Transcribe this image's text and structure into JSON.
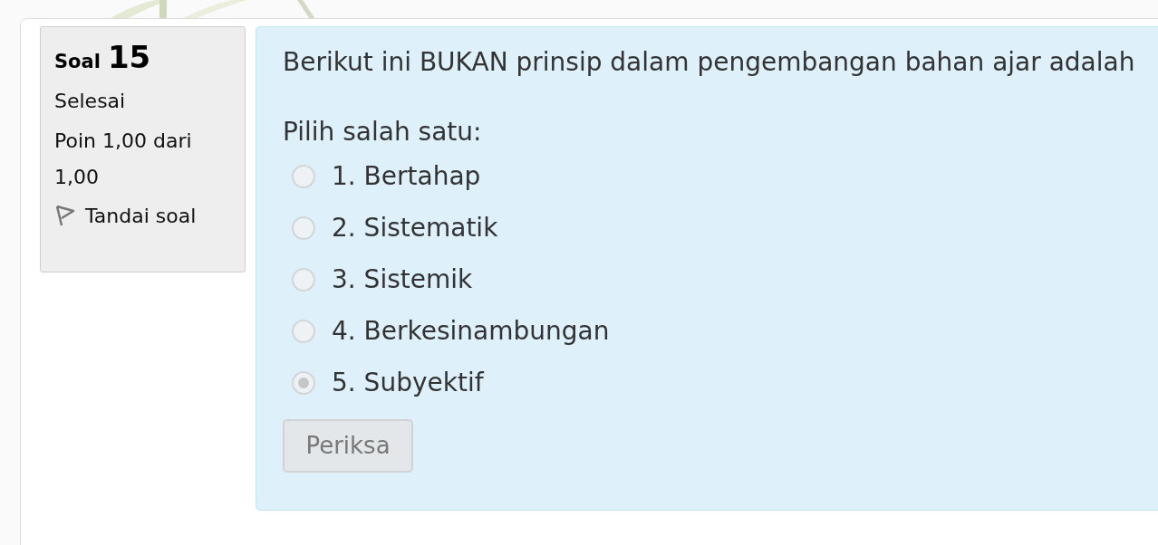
{
  "question_info": {
    "label": "Soal",
    "number": "15",
    "status": "Selesai",
    "grade": "Poin 1,00 dari 1,00",
    "flag": "Tandai soal"
  },
  "question": {
    "text": "Berikut ini BUKAN prinsip dalam pengembangan bahan ajar adalah",
    "prompt": "Pilih salah satu:",
    "options": [
      {
        "label": "1. Bertahap",
        "selected": false
      },
      {
        "label": "2. Sistematik",
        "selected": false
      },
      {
        "label": "3. Sistemik",
        "selected": false
      },
      {
        "label": "4. Berkesinambungan",
        "selected": false
      },
      {
        "label": "5. Subyektif",
        "selected": true
      }
    ],
    "button": {
      "label": "Periksa",
      "disabled": true
    }
  }
}
